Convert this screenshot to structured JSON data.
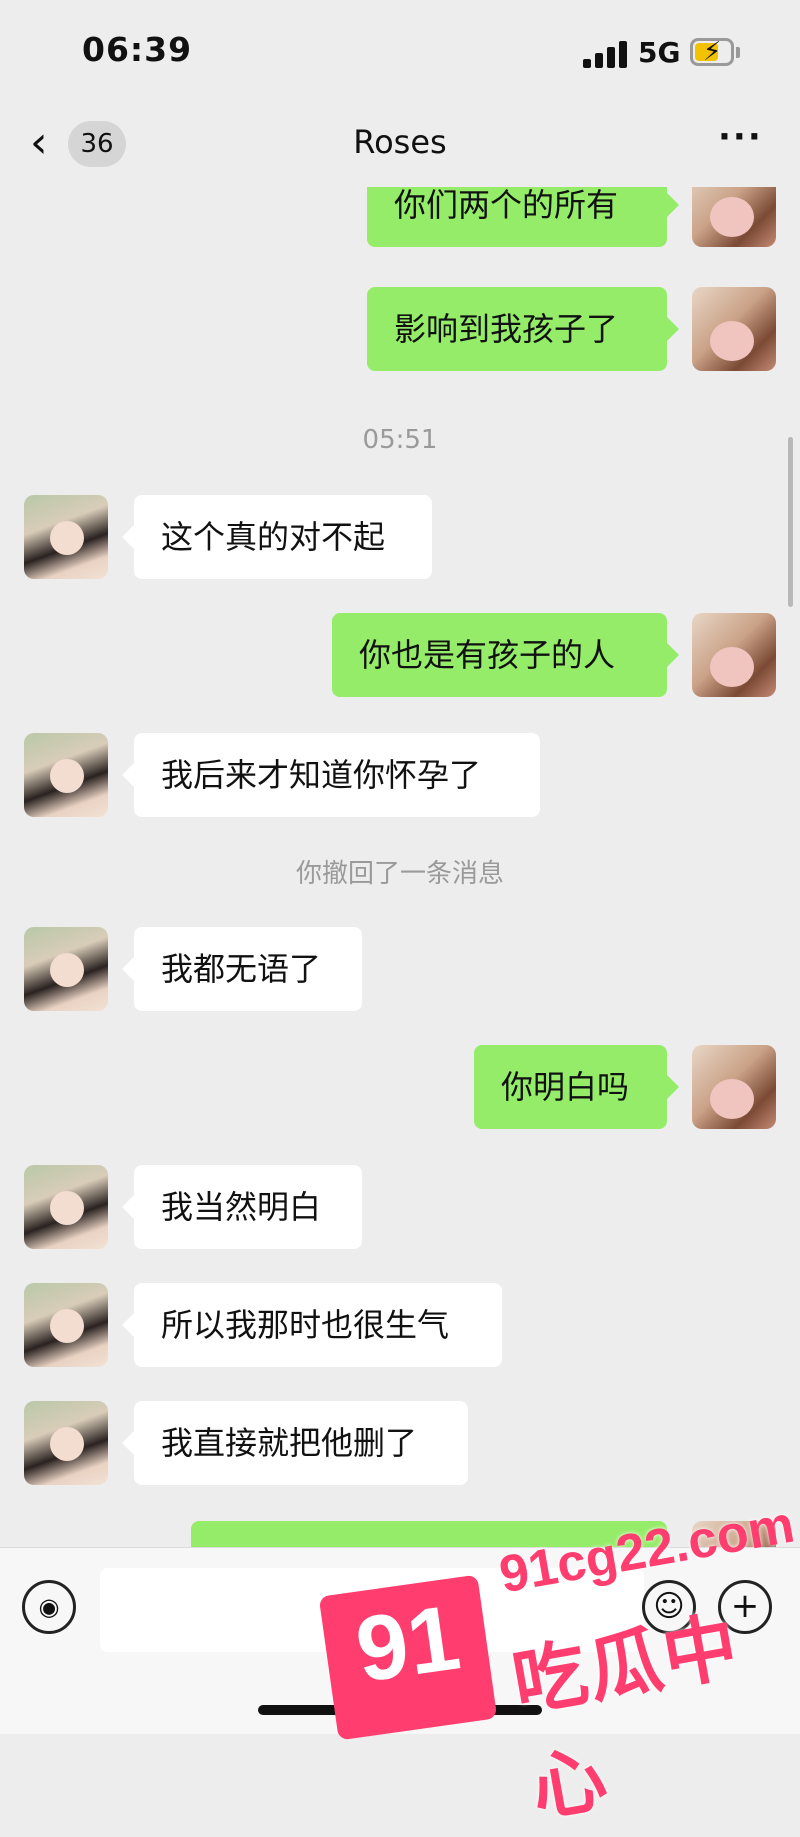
{
  "status_bar": {
    "time": "06:39",
    "network": "5G"
  },
  "nav": {
    "back_count": "36",
    "title": "Roses",
    "more": "···"
  },
  "messages": [
    {
      "side": "out",
      "text": "你们两个的所有"
    },
    {
      "side": "out",
      "text": "影响到我孩子了"
    },
    {
      "type": "time",
      "text": "05:51"
    },
    {
      "side": "in",
      "text": "这个真的对不起"
    },
    {
      "side": "out",
      "text": "你也是有孩子的人"
    },
    {
      "side": "in",
      "text": "我后来才知道你怀孕了"
    },
    {
      "type": "system",
      "text": "你撤回了一条消息"
    },
    {
      "side": "in",
      "text": "我都无语了"
    },
    {
      "side": "out",
      "text": "你明白吗"
    },
    {
      "side": "in",
      "text": "我当然明白"
    },
    {
      "side": "in",
      "text": "所以我那时也很生气"
    },
    {
      "side": "in",
      "text": "我直接就把他删了"
    },
    {
      "side": "out",
      "text": ""
    }
  ],
  "input": {
    "placeholder": ""
  },
  "icons": {
    "back": "chevron-left-icon",
    "more": "more-icon",
    "voice": "voice-icon",
    "emoji": "emoji-icon",
    "plus": "plus-icon"
  },
  "colors": {
    "outgoing_bubble": "#95ec69",
    "incoming_bubble": "#ffffff",
    "background": "#ededed",
    "watermark": "#ff3d6f"
  },
  "watermark": {
    "number": "91",
    "url": "91cg22.com",
    "text": "吃瓜中心"
  }
}
